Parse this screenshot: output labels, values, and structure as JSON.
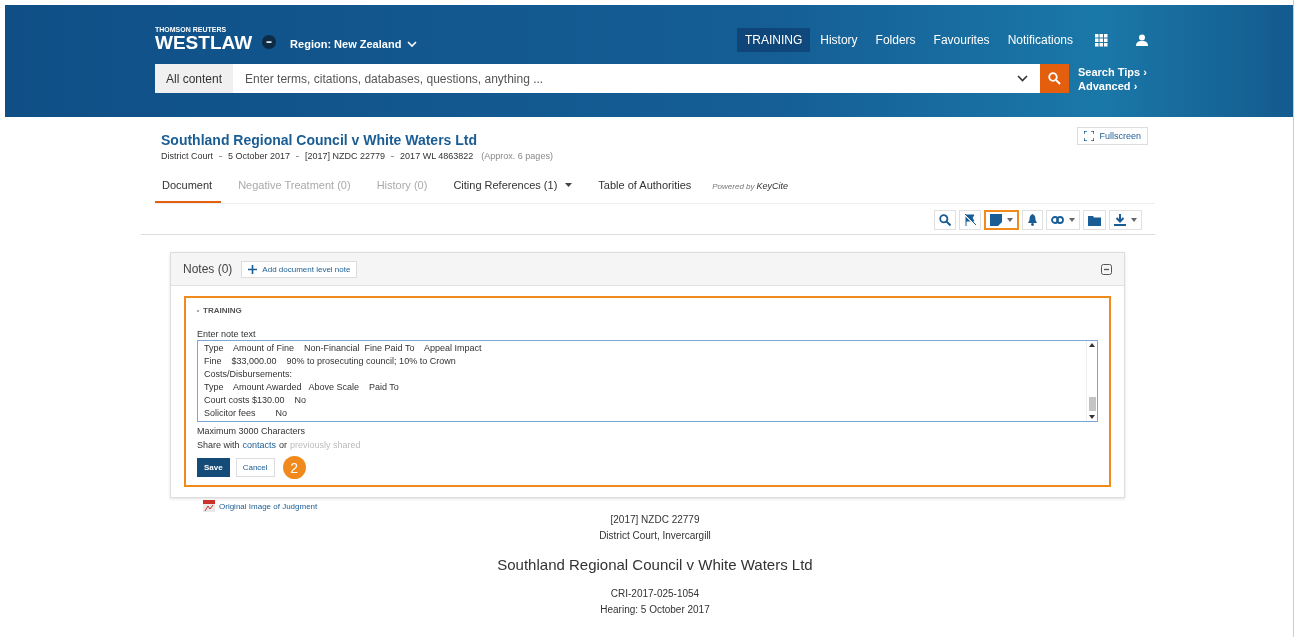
{
  "header": {
    "brand_top": "THOMSON REUTERS",
    "brand": "WESTLAW",
    "region": "Region: New Zealand",
    "nav": [
      {
        "label": "TRAINING",
        "selected": true
      },
      {
        "label": "History",
        "selected": false
      },
      {
        "label": "Folders",
        "selected": false
      },
      {
        "label": "Favourites",
        "selected": false
      },
      {
        "label": "Notifications",
        "selected": false
      }
    ],
    "search": {
      "scope": "All content",
      "placeholder": "Enter terms, citations, databases, questions, anything ..."
    },
    "links": [
      "Search Tips ›",
      "Advanced ›"
    ]
  },
  "document": {
    "title": "Southland Regional Council v White Waters Ltd",
    "fullscreen": "Fullscreen",
    "meta": [
      "District Court",
      "5 October 2017",
      "[2017] NZDC 22779",
      "2017 WL 4863822"
    ],
    "pages": "(Approx. 6 pages)",
    "tabs": [
      {
        "label": "Document",
        "selected": true,
        "disabled": false,
        "dropdown": false
      },
      {
        "label": "Negative Treatment (0)",
        "selected": false,
        "disabled": true,
        "dropdown": false
      },
      {
        "label": "History (0)",
        "selected": false,
        "disabled": true,
        "dropdown": false
      },
      {
        "label": "Citing References (1)",
        "selected": false,
        "disabled": false,
        "dropdown": true
      },
      {
        "label": "Table of Authorities",
        "selected": false,
        "disabled": false,
        "dropdown": false
      }
    ],
    "powered_by": "Powered by",
    "keycite": "KeyCite",
    "tools": [
      {
        "kind": "search",
        "dropdown": false,
        "selected": false
      },
      {
        "kind": "flag",
        "dropdown": false,
        "selected": false
      },
      {
        "kind": "note",
        "dropdown": true,
        "selected": true
      },
      {
        "kind": "bell",
        "dropdown": false,
        "selected": false
      },
      {
        "kind": "link",
        "dropdown": true,
        "selected": false
      },
      {
        "kind": "folder",
        "dropdown": false,
        "selected": false
      },
      {
        "kind": "download",
        "dropdown": true,
        "selected": false
      }
    ]
  },
  "notes": {
    "title": "Notes (0)",
    "add_button": "Add document level note",
    "folder": "TRAINING",
    "field_label": "Enter note text",
    "lines": [
      "Type    Amount of Fine    Non-Financial  Fine Paid To    Appeal Impact",
      "Fine    $33,000.00    90% to prosecuting council; 10% to Crown",
      "Costs/Disbursements:",
      "Type    Amount Awarded   Above Scale    Paid To",
      "Court costs $130.00    No",
      "Solicitor fees        No"
    ],
    "limit": "Maximum 3000 Characters",
    "share_prefix": "Share with",
    "share_link": "contacts",
    "share_or": "or",
    "share_disabled": "previously shared",
    "save": "Save",
    "cancel": "Cancel",
    "step": "2",
    "original_image": "Original Image of Judgment"
  },
  "body": {
    "citation": "[2017] NZDC 22779",
    "court": "District Court, Invercargill",
    "title": "Southland Regional Council v White Waters Ltd",
    "number": "CRI-2017-025-1054",
    "hearing": "Hearing: 5 October 2017"
  }
}
